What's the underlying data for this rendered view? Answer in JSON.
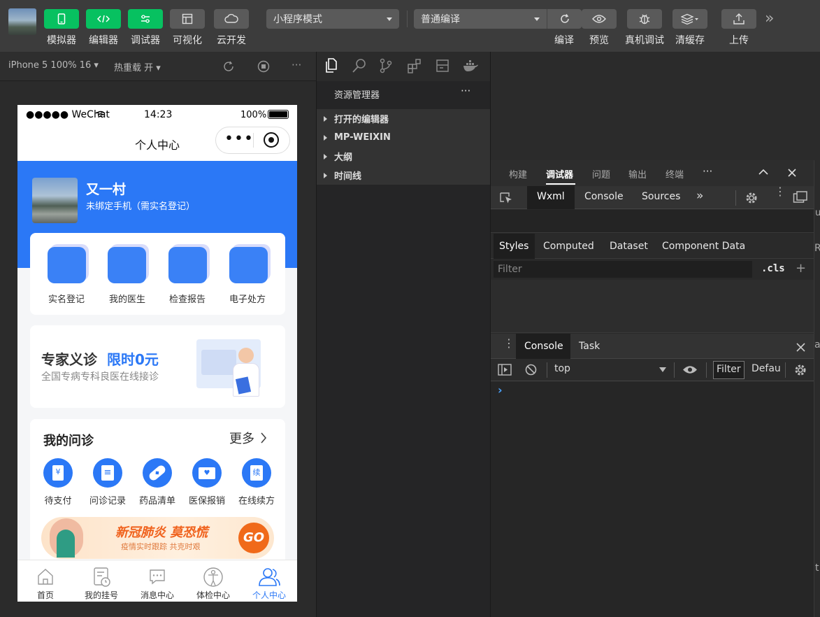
{
  "toolbar": {
    "buttons": [
      {
        "label": "模拟器",
        "style": "green",
        "icon": "phone-icon"
      },
      {
        "label": "编辑器",
        "style": "green",
        "icon": "code-icon"
      },
      {
        "label": "调试器",
        "style": "green",
        "icon": "debug-icon"
      },
      {
        "label": "可视化",
        "style": "gray",
        "icon": "layout-icon"
      },
      {
        "label": "云开发",
        "style": "gray",
        "icon": "cloud-icon"
      }
    ],
    "mode_select": "小程序模式",
    "compile_select": "普通编译",
    "right_buttons": [
      {
        "label": "编译",
        "icon": "refresh-icon"
      },
      {
        "label": "预览",
        "icon": "eye-icon"
      },
      {
        "label": "真机调试",
        "icon": "bug-icon"
      },
      {
        "label": "清缓存",
        "icon": "layers-icon"
      },
      {
        "label": "上传",
        "icon": "upload-icon"
      }
    ],
    "more": "»"
  },
  "simulator_bar": {
    "device": "iPhone 5 100% 16 ▾",
    "hot_reload": "热重载 开 ▾",
    "more": "···"
  },
  "phone": {
    "status": {
      "carrier": "●●●●● WeChat",
      "time": "14:23",
      "battery": "100%"
    },
    "nav_title": "个人中心",
    "capsule_dots": "•••",
    "profile": {
      "name": "又一村",
      "subtitle": "未绑定手机（需实名登记）"
    },
    "quick_actions": [
      "实名登记",
      "我的医生",
      "检查报告",
      "电子处方"
    ],
    "banner": {
      "title": "专家义诊",
      "highlight": "限时0元",
      "subtitle": "全国专病专科良医在线接诊"
    },
    "inquiry": {
      "title": "我的问诊",
      "more": "更多",
      "items": [
        {
          "label": "待支付",
          "glyph": "¥"
        },
        {
          "label": "问诊记录",
          "glyph": "≡"
        },
        {
          "label": "药品清单",
          "glyph": "◆"
        },
        {
          "label": "医保报销",
          "glyph": "♥"
        },
        {
          "label": "在线续方",
          "glyph": "续"
        }
      ]
    },
    "promo": {
      "title": "新冠肺炎 莫恐慌",
      "subtitle": "疫情实时跟踪 共克时艰",
      "go": "GO"
    },
    "tabbar": [
      {
        "label": "首页",
        "active": false,
        "icon": "home-icon"
      },
      {
        "label": "我的挂号",
        "active": false,
        "icon": "register-icon"
      },
      {
        "label": "消息中心",
        "active": false,
        "icon": "message-icon"
      },
      {
        "label": "体检中心",
        "active": false,
        "icon": "checkup-icon"
      },
      {
        "label": "个人中心",
        "active": true,
        "icon": "user-icon"
      }
    ]
  },
  "explorer": {
    "title": "资源管理器",
    "more": "···",
    "sections": [
      "打开的编辑器",
      "MP-WEIXIN",
      "大纲",
      "时间线"
    ]
  },
  "devtools": {
    "top_tabs": [
      "构建",
      "调试器",
      "问题",
      "输出",
      "终端"
    ],
    "top_more": "···",
    "panel_tabs": [
      "Wxml",
      "Console",
      "Sources"
    ],
    "panel_more": "»",
    "style_tabs": [
      "Styles",
      "Computed",
      "Dataset",
      "Component Data"
    ],
    "filter_placeholder": "Filter",
    "cls": ".cls",
    "plus": "+",
    "console_tabs": [
      "Console",
      "Task"
    ],
    "context": "top",
    "filter_btn": "Filter",
    "levels": "Defau",
    "prompt": "›",
    "edge_letters": [
      "u",
      "R",
      "a",
      "t"
    ]
  },
  "colors": {
    "green": "#07c160",
    "brand_blue": "#2b78f6",
    "toolbar": "#3c3c3c"
  }
}
